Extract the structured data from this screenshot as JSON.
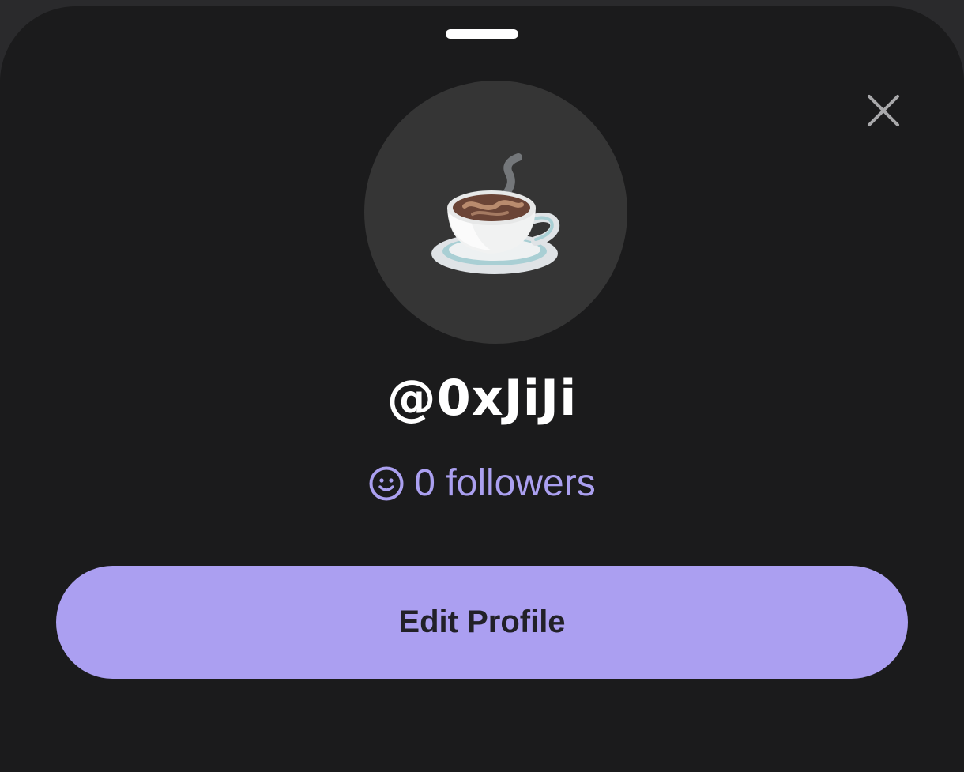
{
  "sheet": {
    "close_icon": "close-icon",
    "avatar_icon": "coffee-cup-icon"
  },
  "profile": {
    "username": "@0xJiJi",
    "followers_text": "0 followers",
    "followers_icon": "smiley-icon"
  },
  "actions": {
    "edit_profile_label": "Edit Profile"
  },
  "colors": {
    "background": "#1b1b1c",
    "accent": "#ab9ff1",
    "avatar_bg": "#353535",
    "text_primary": "#ffffff",
    "button_text": "#222128"
  }
}
